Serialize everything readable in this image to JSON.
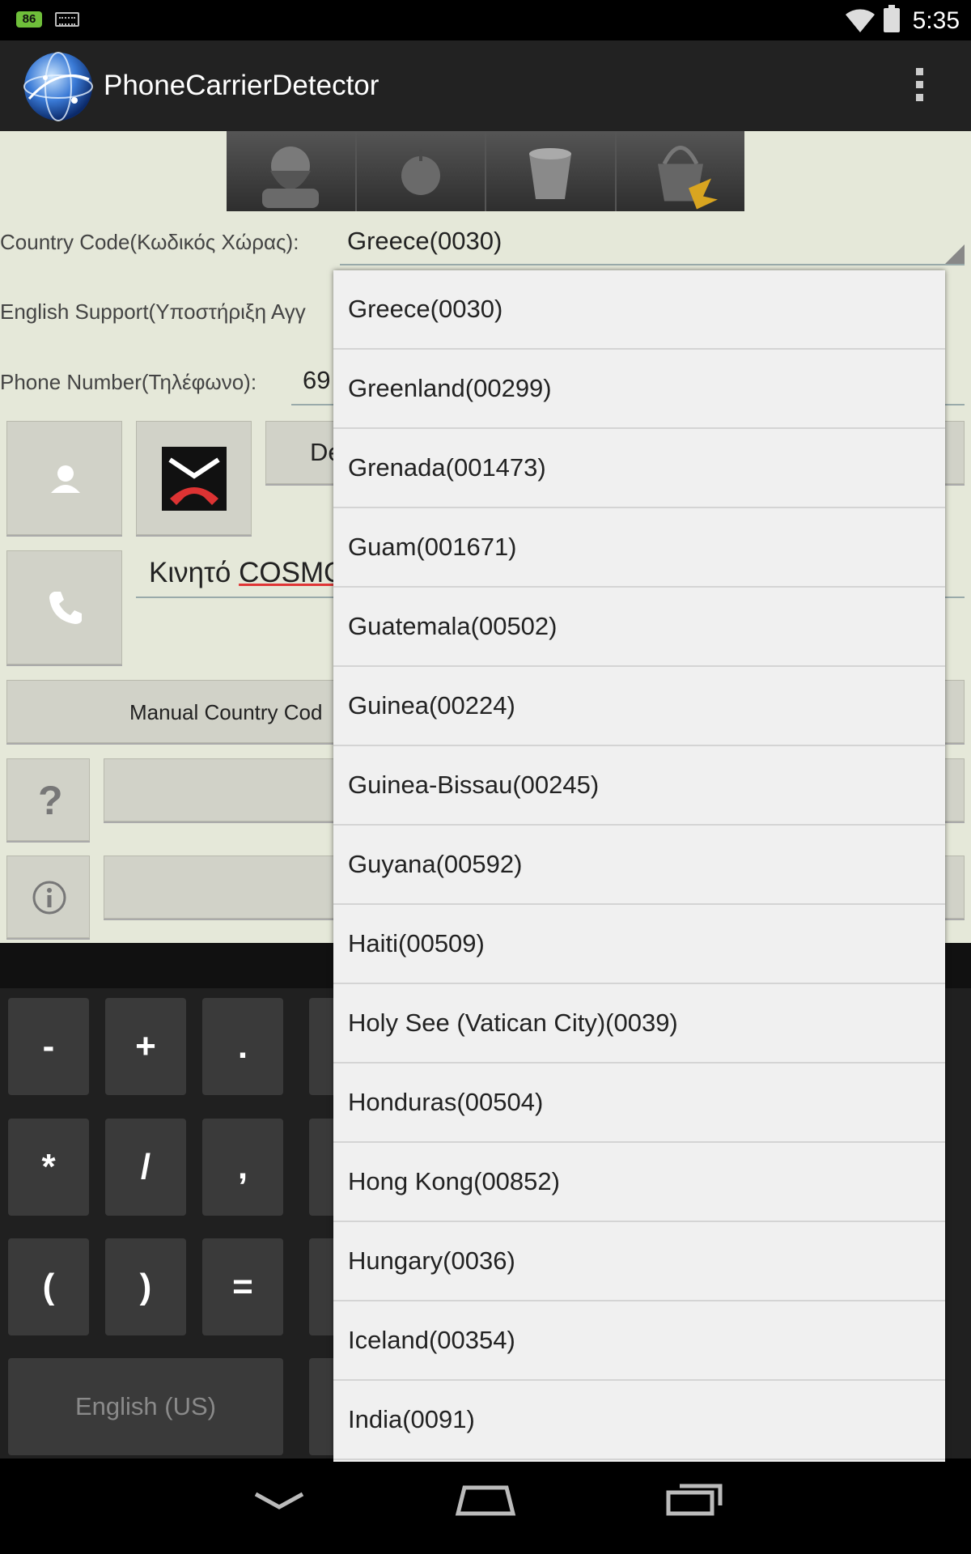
{
  "status_bar": {
    "battery_level": "86",
    "time": "5:35"
  },
  "app_bar": {
    "title": "PhoneCarrierDetector",
    "logo_icon": "globe-icon",
    "overflow_icon": "overflow-menu-icon"
  },
  "image_tabs": [
    {
      "icon": "bearded-man-icon"
    },
    {
      "icon": "apple-icon"
    },
    {
      "icon": "bucket-icon"
    },
    {
      "icon": "basket-icon"
    }
  ],
  "form": {
    "country_code_label": "Country Code(Κωδικός Χώρας):",
    "country_code_value": "Greece(0030)",
    "english_support_label": "English Support(Υποστήριξη Αγγ",
    "phone_number_label": "Phone Number(Τηλέφωνο):",
    "phone_number_value": "69",
    "detect_button_label": "De",
    "carrier_prefix": "Κινητό ",
    "carrier_name": "COSMO",
    "manual_country_button": "Manual Country Cod",
    "help_label": "?",
    "info_icon": "info-icon",
    "contact_icon": "contact-icon",
    "block_call_icon": "block-call-icon",
    "call_icon": "phone-icon"
  },
  "dropdown": {
    "items": [
      "Greece(0030)",
      "Greenland(00299)",
      "Grenada(001473)",
      "Guam(001671)",
      "Guatemala(00502)",
      "Guinea(00224)",
      "Guinea-Bissau(00245)",
      "Guyana(00592)",
      "Haiti(00509)",
      "Holy See (Vatican City)(0039)",
      "Honduras(00504)",
      "Hong Kong(00852)",
      "Hungary(0036)",
      "Iceland(00354)",
      "India(0091)"
    ]
  },
  "keyboard": {
    "keys": [
      "-",
      "+",
      ".",
      "*",
      "/",
      ",",
      "(",
      ")",
      "="
    ],
    "language_key": "English (US)"
  },
  "nav_bar": {
    "back_icon": "back-icon",
    "home_icon": "home-icon",
    "recents_icon": "recents-icon"
  }
}
